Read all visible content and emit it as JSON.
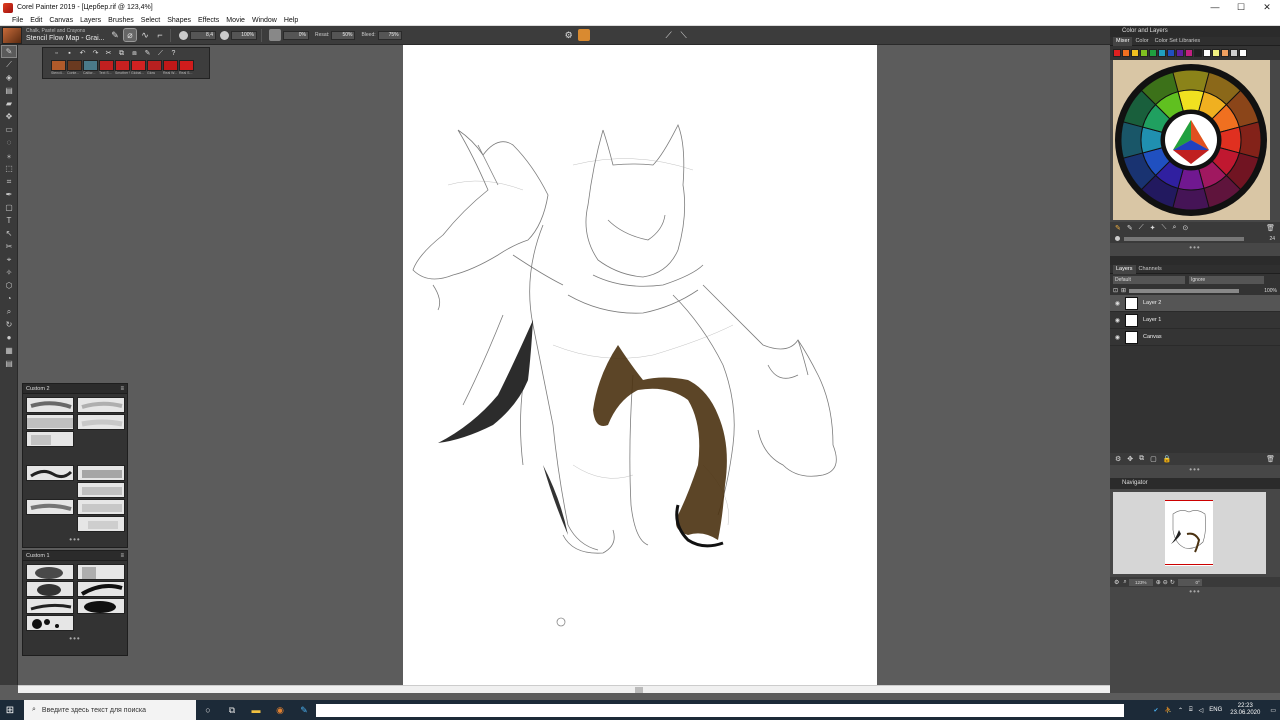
{
  "window": {
    "title": "Corel Painter 2019 - [Цербер.rif @ 123,4%]",
    "controls": [
      "—",
      "☐",
      "✕"
    ]
  },
  "menu": [
    "File",
    "Edit",
    "Canvas",
    "Layers",
    "Brushes",
    "Select",
    "Shapes",
    "Effects",
    "Movie",
    "Window",
    "Help"
  ],
  "propbar": {
    "brush_category": "Chalk, Pastel and Crayons",
    "brush_variant": "Stencil Flow Map - Grai...",
    "size": "8,4",
    "opacity": "100%",
    "grain": "0%",
    "resat_label": "Resat:",
    "resat_value": "50%",
    "bleed_label": "Bleed:",
    "bleed_value": "75%"
  },
  "variants": [
    {
      "name": "Stencil...",
      "color": "#b05a2a"
    },
    {
      "name": "Conte...",
      "color": "#6a3a20"
    },
    {
      "name": "Callicr...",
      "color": "#4a7a8a"
    },
    {
      "name": "Text S...",
      "color": "#c02020"
    },
    {
      "name": "Smother Wet S...",
      "color": "#c82020"
    },
    {
      "name": "Global...",
      "color": "#d02222"
    },
    {
      "name": "Glow",
      "color": "#b82020"
    },
    {
      "name": "Real W...",
      "color": "#c01818"
    },
    {
      "name": "Real S...",
      "color": "#d01c1c"
    }
  ],
  "custom2": {
    "title": "Custom 2",
    "more": "•••"
  },
  "custom1": {
    "title": "Custom 1",
    "more": "•••"
  },
  "color_and_layers": {
    "title": "Color and Layers"
  },
  "color_tabs": [
    "Mixer",
    "Color",
    "Color Set Libraries"
  ],
  "swatch_colors": [
    "#e02020",
    "#f07020",
    "#f0c020",
    "#80c020",
    "#20a040",
    "#20a0c0",
    "#2050c0",
    "#6020a0",
    "#c02080",
    "#202020",
    "#ffffff",
    "#f0f080",
    "#f0a060",
    "#d0d0d0",
    "#ffffff"
  ],
  "color_controls": {
    "value": "24",
    "more": "•••"
  },
  "layers": {
    "tabs": [
      "Layers",
      "Channels"
    ],
    "composite_method": "Default",
    "composite_depth": "Ignore",
    "opacity": "100%",
    "items": [
      {
        "name": "Layer 2",
        "selected": true
      },
      {
        "name": "Layer 1",
        "selected": false
      },
      {
        "name": "Canvas",
        "selected": false
      }
    ],
    "more": "•••"
  },
  "navigator": {
    "title": "Navigator",
    "zoom": "123%",
    "angle": "0°",
    "more": "•••"
  },
  "taskbar": {
    "search_placeholder": "Введите здесь текст для поиска",
    "lang": "ENG",
    "time": "22:23",
    "date": "23.06.2020"
  }
}
